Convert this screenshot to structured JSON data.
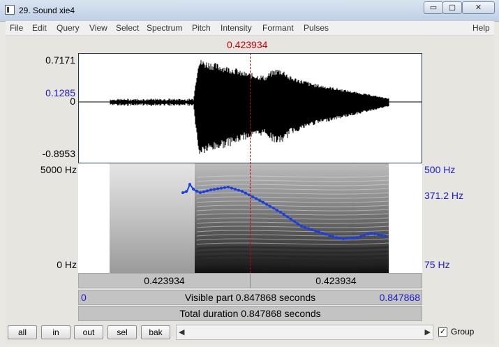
{
  "window": {
    "title": "29. Sound xie4",
    "min": "▭",
    "max": "▢",
    "close": "✕"
  },
  "menu": [
    "File",
    "Edit",
    "Query",
    "View",
    "Select",
    "Spectrum",
    "Pitch",
    "Intensity",
    "Formant",
    "Pulses"
  ],
  "help": "Help",
  "cursor_time": "0.423934",
  "wave": {
    "max": "0.7171",
    "cursor_value": "0.1285",
    "zero": "0",
    "min": "-0.8953"
  },
  "spectrogram": {
    "top": "5000 Hz",
    "bottom": "0 Hz"
  },
  "pitch": {
    "top": "500 Hz",
    "cursor_value": "371.2 Hz",
    "bottom": "75 Hz"
  },
  "bars": {
    "left_time": "0.423934",
    "right_time": "0.423934",
    "visible_start": "0",
    "visible_text": "Visible part 0.847868 seconds",
    "visible_end": "0.847868",
    "total_text": "Total duration 0.847868 seconds"
  },
  "buttons": {
    "all": "all",
    "in": "in",
    "out": "out",
    "sel": "sel",
    "bak": "bak"
  },
  "scroll": {
    "left_arrow": "◀",
    "right_arrow": "▶"
  },
  "group": {
    "label": "Group",
    "checked": "✓"
  }
}
